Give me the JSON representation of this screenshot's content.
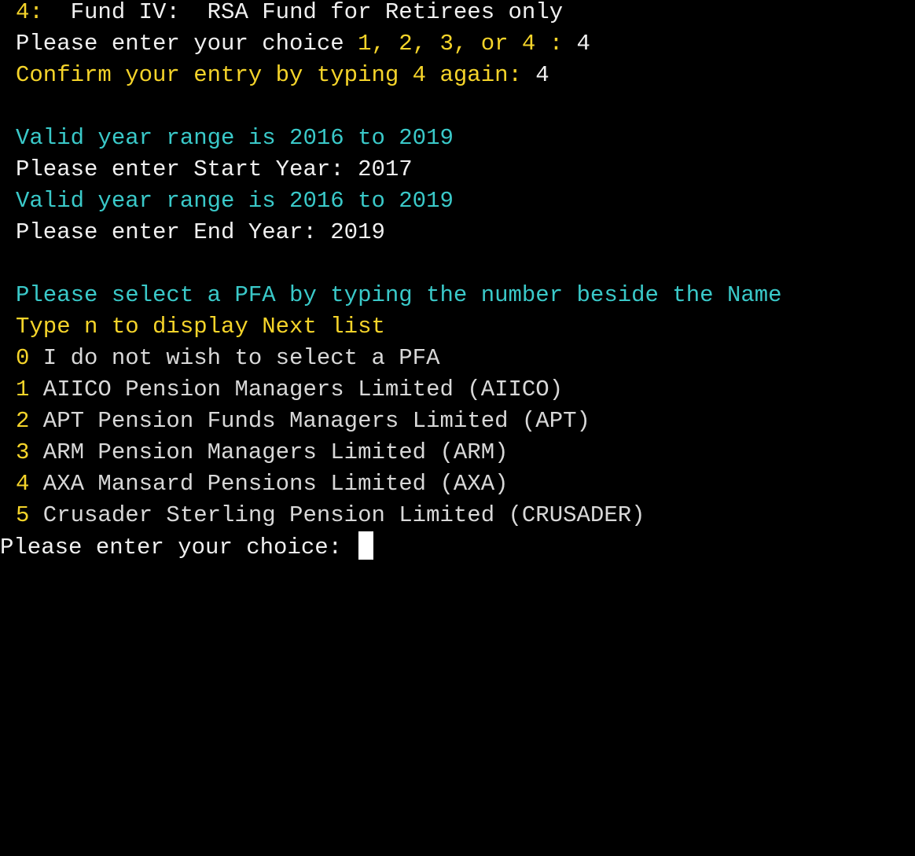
{
  "terminal": {
    "fund_line": {
      "num": "4:",
      "text": "  Fund IV:  RSA Fund for Retirees only"
    },
    "choice_prompt": {
      "text": "Please enter your choice ",
      "options": "1, 2, 3, or 4 :",
      "value": " 4"
    },
    "confirm_prompt": {
      "text": "Confirm your entry by typing 4 again:",
      "value": " 4"
    },
    "valid_range_1": "Valid year range is 2016 to 2019",
    "start_year": {
      "label": "Please enter Start Year:",
      "value": " 2017"
    },
    "valid_range_2": "Valid year range is 2016 to 2019",
    "end_year": {
      "label": "Please enter End Year:",
      "value": " 2019"
    },
    "pfa_instruction": "Please select a PFA by typing the number beside the Name",
    "next_hint": "Type n to display Next list",
    "pfa_list": [
      {
        "num": "0",
        "name": " I do not wish to select a PFA"
      },
      {
        "num": "1",
        "name": " AIICO Pension Managers Limited (AIICO)"
      },
      {
        "num": "2",
        "name": " APT Pension Funds Managers Limited (APT)"
      },
      {
        "num": "3",
        "name": " ARM Pension Managers Limited (ARM)"
      },
      {
        "num": "4",
        "name": " AXA Mansard Pensions Limited (AXA)"
      },
      {
        "num": "5",
        "name": " Crusader Sterling Pension Limited (CRUSADER)"
      }
    ],
    "final_prompt": "Please enter your choice: ",
    "colors": {
      "background": "#000000",
      "yellow": "#f5d42a",
      "cyan": "#3ac9c9",
      "white": "#f0f0f0"
    }
  }
}
